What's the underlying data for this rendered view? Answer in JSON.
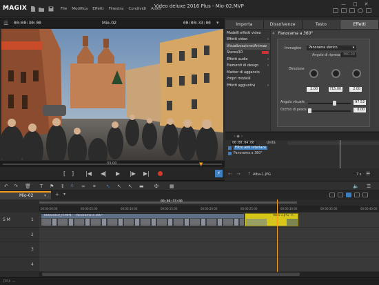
{
  "app": {
    "logo": "MAGIX",
    "title": "Video deluxe 2016 Plus - Mio-02.MVP",
    "menu": [
      "File",
      "Modifica",
      "Effetti",
      "Finestra",
      "Condividi",
      "Aiuto"
    ]
  },
  "preview": {
    "timecode_left": "00:00:30:00",
    "project_name": "Mio-02",
    "timecode_right": "00:00:33:00",
    "scrub_time": "33:00"
  },
  "tabs": [
    "Importa",
    "Dissolvenze",
    "Testo",
    "Effetti"
  ],
  "active_tab": "Effetti",
  "effects_list": {
    "items": [
      "Modelli effetti video",
      "Effetti video",
      "Visualizzazione/Animaz",
      "Stereo3D",
      "Effetti audio",
      "Elementi di design",
      "Marker di aggancio",
      "Propri modelli",
      "Effetti aggiuntivi"
    ],
    "selected": "Visualizzazione/Animaz"
  },
  "effect_panel": {
    "title": "Panorama a 360°",
    "image_label": "Immagine",
    "image_value": "Panorama sferico",
    "shoot_angle_label": "Angolo di ripresa",
    "shoot_angle_value": "360.00",
    "direction_label": "Direzione",
    "dir_values": [
      "2.00",
      "715.00",
      "2.00"
    ],
    "visual_angle_label": "Angolo visuale",
    "visual_angle_value": "97.53",
    "fisheye_label": "Occhio di pesce",
    "fisheye_value": "0.00"
  },
  "keyframes": {
    "timecode": "00:00:04:00",
    "unit_label": "Unità",
    "rows": [
      "Filtro anti interlace",
      "Panorama a 360°"
    ]
  },
  "nav": {
    "file_name": "Alba-1.JPG",
    "duration": "7 s"
  },
  "timeline": {
    "tab_name": "Mio-02",
    "tab_add": "+",
    "ruler_time": "00:00:33:00",
    "ruler_ticks": [
      "00:00:00:00",
      "00:00:05:00",
      "00:00:10:00",
      "00:00:15:00",
      "00:00:20:00",
      "00:00:25:00",
      "00:00:30:00",
      "00:00:35:00",
      "00:00:40:00"
    ],
    "track_numbers": [
      "1",
      "2",
      "3",
      "4"
    ],
    "track_controls": "S M",
    "clip_labels": [
      "00055010_rt.MP4",
      "Panorama a 360°",
      "Alba-1.JPG",
      "P..."
    ]
  },
  "status": {
    "cpu_label": "CPU: —"
  },
  "colors": {
    "accent": "#f39c1d",
    "clip_yellow": "#d7c61a",
    "tab_active": "#525252",
    "record": "#d33a2a",
    "blue_active": "#3d7fc1"
  }
}
